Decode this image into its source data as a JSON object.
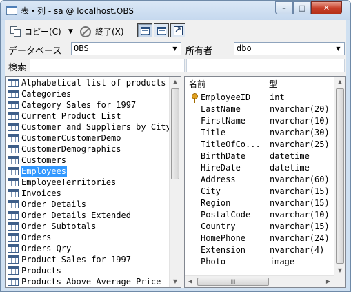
{
  "window": {
    "title": "表・列 - sa @ localhost.OBS",
    "minimize": "–",
    "maximize": "□",
    "close": "✕"
  },
  "toolbar": {
    "copy_label": "コピー(C)",
    "dropdown_arrow": "▼",
    "exit_label": "終了(X)"
  },
  "database": {
    "label": "データベース",
    "value": "OBS"
  },
  "owner": {
    "label": "所有者",
    "value": "dbo"
  },
  "search": {
    "label": "検索",
    "value": ""
  },
  "tables": [
    "Alphabetical list of products",
    "Categories",
    "Category Sales for 1997",
    "Current Product List",
    "Customer and Suppliers by City",
    "CustomerCustomerDemo",
    "CustomerDemographics",
    "Customers",
    "Employees",
    "EmployeeTerritories",
    "Invoices",
    "Order Details",
    "Order Details Extended",
    "Order Subtotals",
    "Orders",
    "Orders Qry",
    "Product Sales for 1997",
    "Products",
    "Products Above Average Price"
  ],
  "selected_table_index": 8,
  "columns_header": {
    "name": "名前",
    "type": "型"
  },
  "columns": [
    {
      "name": "EmployeeID",
      "type": "int",
      "key": true
    },
    {
      "name": "LastName",
      "type": "nvarchar(20)",
      "key": false
    },
    {
      "name": "FirstName",
      "type": "nvarchar(10)",
      "key": false
    },
    {
      "name": "Title",
      "type": "nvarchar(30)",
      "key": false
    },
    {
      "name": "TitleOfCo...",
      "type": "nvarchar(25)",
      "key": false
    },
    {
      "name": "BirthDate",
      "type": "datetime",
      "key": false
    },
    {
      "name": "HireDate",
      "type": "datetime",
      "key": false
    },
    {
      "name": "Address",
      "type": "nvarchar(60)",
      "key": false
    },
    {
      "name": "City",
      "type": "nvarchar(15)",
      "key": false
    },
    {
      "name": "Region",
      "type": "nvarchar(15)",
      "key": false
    },
    {
      "name": "PostalCode",
      "type": "nvarchar(10)",
      "key": false
    },
    {
      "name": "Country",
      "type": "nvarchar(15)",
      "key": false
    },
    {
      "name": "HomePhone",
      "type": "nvarchar(24)",
      "key": false
    },
    {
      "name": "Extension",
      "type": "nvarchar(4)",
      "key": false
    },
    {
      "name": "Photo",
      "type": "image",
      "key": false
    }
  ],
  "icons": {
    "title": "table-window-icon",
    "copy": "copy-icon",
    "exit": "stop-icon",
    "view_grid": "grid-view-icon",
    "view_grid2": "grid-view-alt-icon",
    "view_arrow": "open-arrow-icon",
    "table": "table-icon",
    "key": "primary-key-icon"
  },
  "colors": {
    "selection": "#3399ff",
    "window_frame": "#cfe0f1",
    "close_button": "#c8402a"
  }
}
